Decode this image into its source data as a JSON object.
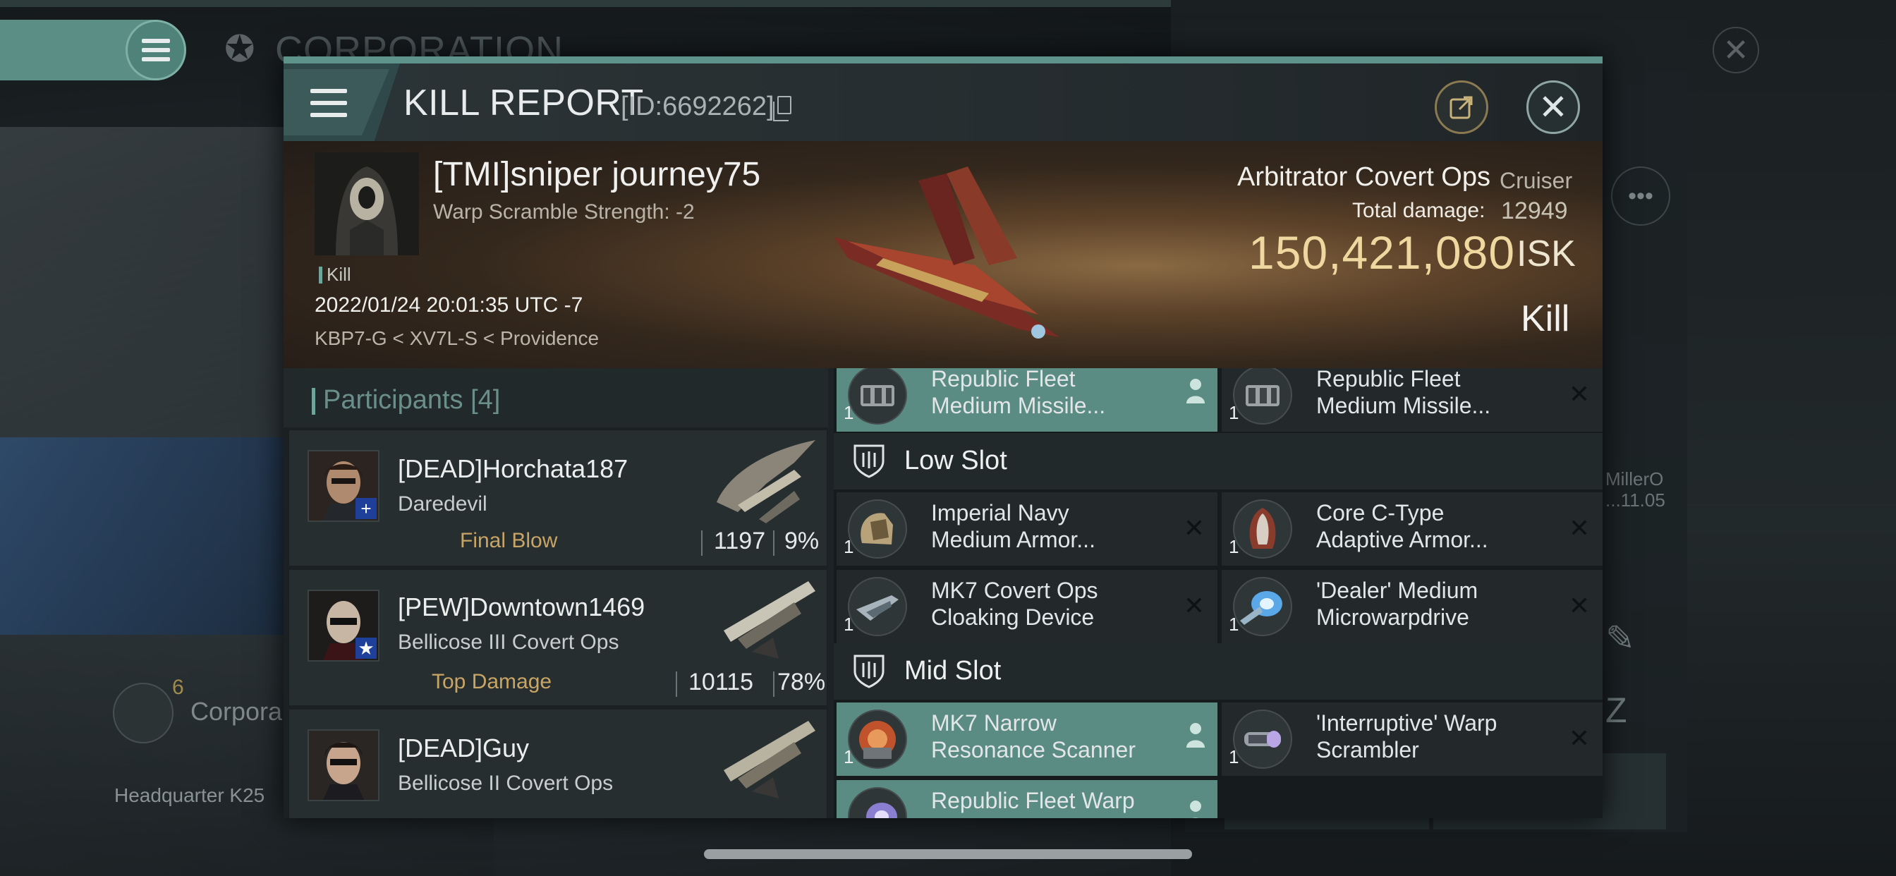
{
  "background": {
    "corp_title": "CORPORATION",
    "corpo_label": "Corpora",
    "corpo_count": "6",
    "headquarter": "Headquarter K25",
    "side_name": "MillerO",
    "side_date": "...11.05"
  },
  "dialog": {
    "title": "KILL REPORT",
    "id_text": "[ID:6692262]"
  },
  "victim": {
    "name": "[TMI]sniper journey75",
    "warp_scramble": "Warp Scramble Strength: -2",
    "kill_tag": "Kill",
    "datetime": "2022/01/24 20:01:35 UTC -7",
    "location": "KBP7-G < XV7L-S < Providence",
    "ship_name": "Arbitrator Covert Ops",
    "ship_class": "Cruiser",
    "total_damage_label": "Total damage:",
    "total_damage": "12949",
    "isk_value": "150,421,080",
    "isk_label": "ISK",
    "result": "Kill"
  },
  "participants": {
    "title": "Participants",
    "count": "[4]",
    "items": [
      {
        "name": "[DEAD]Horchata187",
        "ship": "Daredevil",
        "tag": "Final Blow",
        "damage": "1197",
        "percent": "9%",
        "badge": "+"
      },
      {
        "name": "[PEW]Downtown1469",
        "ship": "Bellicose III Covert Ops",
        "tag": "Top Damage",
        "damage": "10115",
        "percent": "78%",
        "badge": "★"
      },
      {
        "name": "[DEAD]Guy",
        "ship": "Bellicose II Covert Ops",
        "tag": "",
        "damage": "",
        "percent": "",
        "badge": ""
      }
    ]
  },
  "modules": {
    "top_left": {
      "qty": "1",
      "name_1": "Republic Fleet",
      "name_2": "Medium Missile..."
    },
    "top_right": {
      "qty": "1",
      "name_1": "Republic Fleet",
      "name_2": "Medium Missile..."
    },
    "low_slot_title": "Low Slot",
    "low": [
      {
        "qty": "1",
        "name_1": "Imperial Navy",
        "name_2": "Medium Armor..."
      },
      {
        "qty": "1",
        "name_1": "Core C-Type",
        "name_2": "Adaptive Armor..."
      },
      {
        "qty": "1",
        "name_1": "MK7 Covert Ops",
        "name_2": "Cloaking Device"
      },
      {
        "qty": "1",
        "name_1": "'Dealer' Medium",
        "name_2": "Microwarpdrive"
      }
    ],
    "mid_slot_title": "Mid Slot",
    "mid": [
      {
        "qty": "1",
        "name_1": "MK7 Narrow",
        "name_2": "Resonance Scanner"
      },
      {
        "qty": "1",
        "name_1": "'Interruptive' Warp",
        "name_2": "Scrambler"
      },
      {
        "qty": "",
        "name_1": "Republic Fleet Warp",
        "name_2": ""
      }
    ],
    "close_glyph": "✕"
  },
  "colors": {
    "accent_teal": "#5a8c84",
    "isk_gold": "#efd7a0",
    "tag_gold": "#c9a565",
    "badge_blue": "#1e3f9a"
  },
  "icons": {
    "menu": "hamburger-icon",
    "copy": "copy-icon",
    "share": "share-icon",
    "close": "close-icon",
    "slot": "shield-icon",
    "owner": "person-icon"
  }
}
